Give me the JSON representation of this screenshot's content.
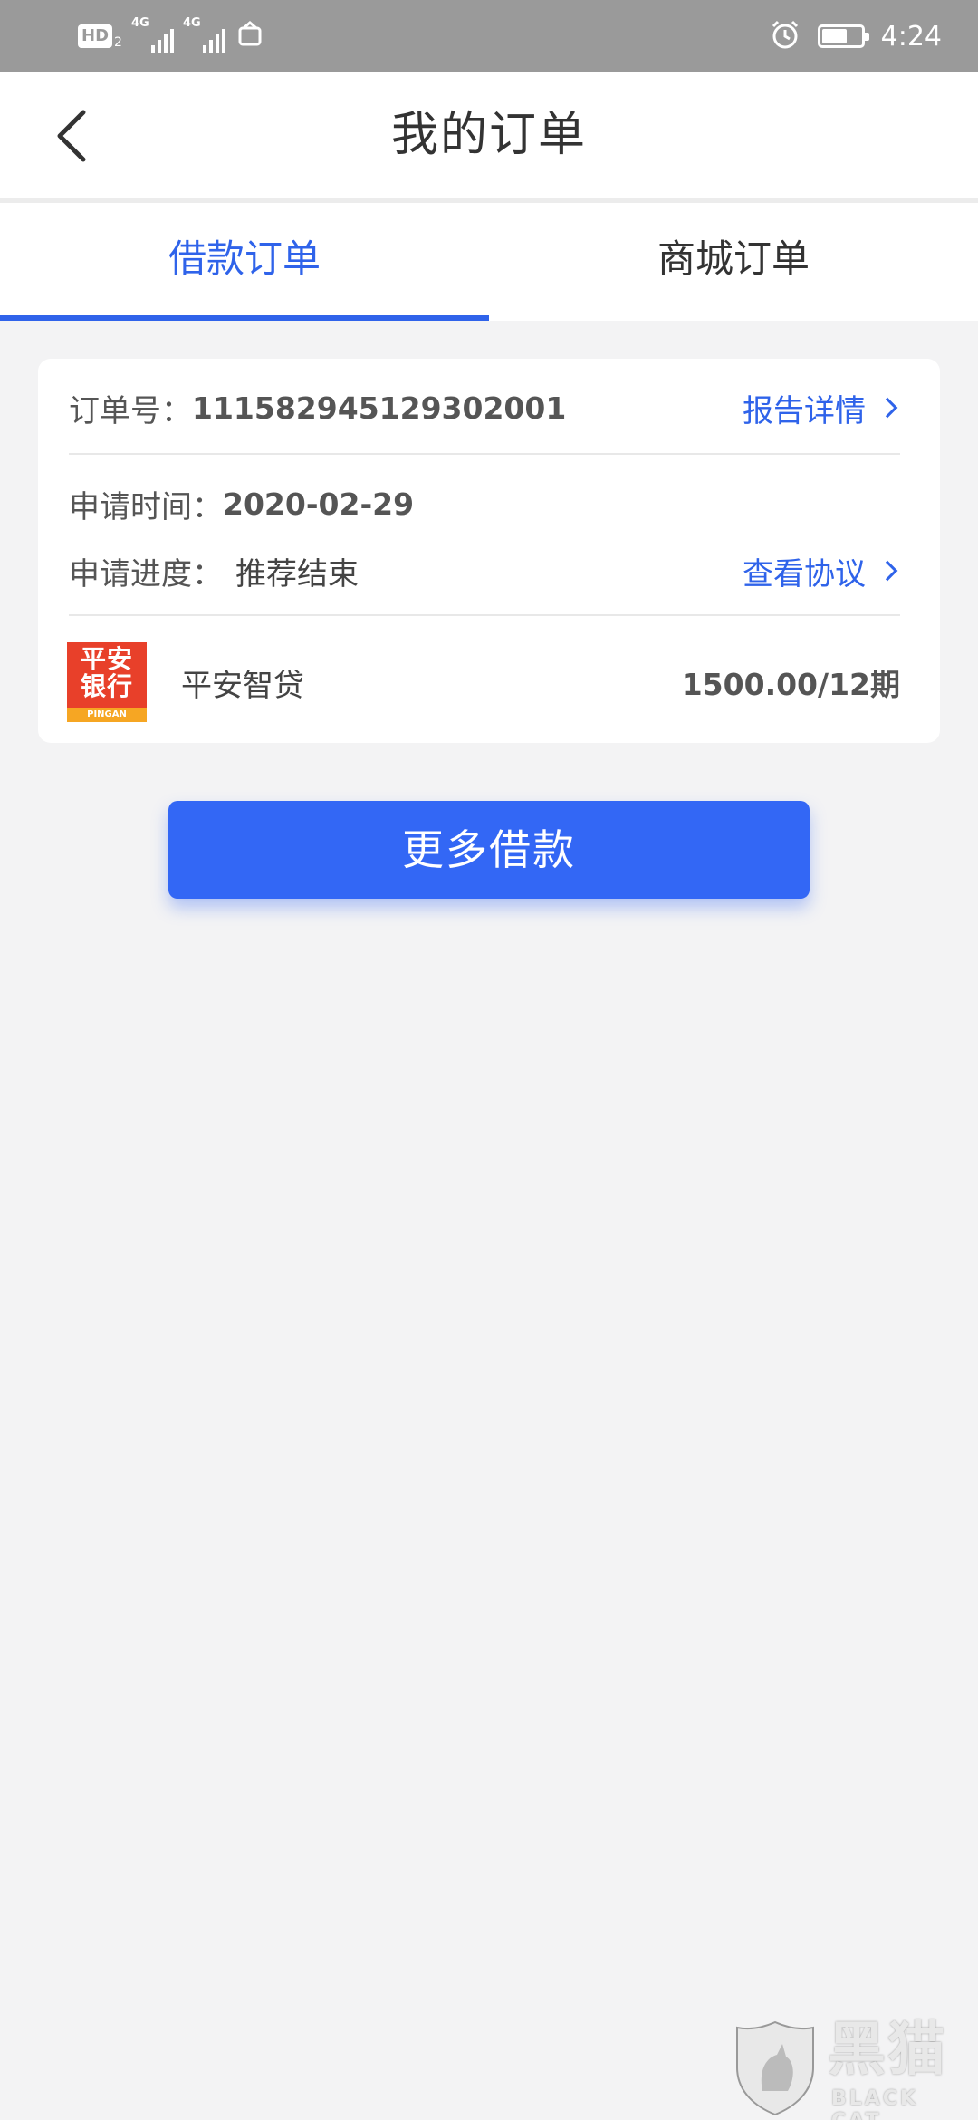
{
  "status_bar": {
    "hd_label": "HD",
    "hd_sub": "2",
    "network_1": "4G",
    "network_2": "4G",
    "time": "4:24"
  },
  "header": {
    "title": "我的订单"
  },
  "tabs": [
    {
      "label": "借款订单",
      "active": true
    },
    {
      "label": "商城订单",
      "active": false
    }
  ],
  "order": {
    "order_no_label": "订单号：",
    "order_no": "111582945129302001",
    "report_link": "报告详情",
    "apply_time_label": "申请时间：",
    "apply_time": "2020-02-29",
    "progress_label": "申请进度：",
    "progress_value": "推荐结束",
    "agreement_link": "查看协议",
    "product": {
      "logo_text_line1": "平安",
      "logo_text_line2": "银行",
      "logo_sub": "PINGAN",
      "name": "平安智贷",
      "amount": "1500.00/12期"
    }
  },
  "actions": {
    "more_loans": "更多借款"
  },
  "watermark": {
    "cn": "黑猫",
    "en": "BLACK CAT"
  },
  "colors": {
    "accent": "#2f63ea",
    "button": "#3367f5",
    "background": "#f3f3f4",
    "status_bar": "#9a9a9a",
    "logo_red": "#e8402a"
  }
}
